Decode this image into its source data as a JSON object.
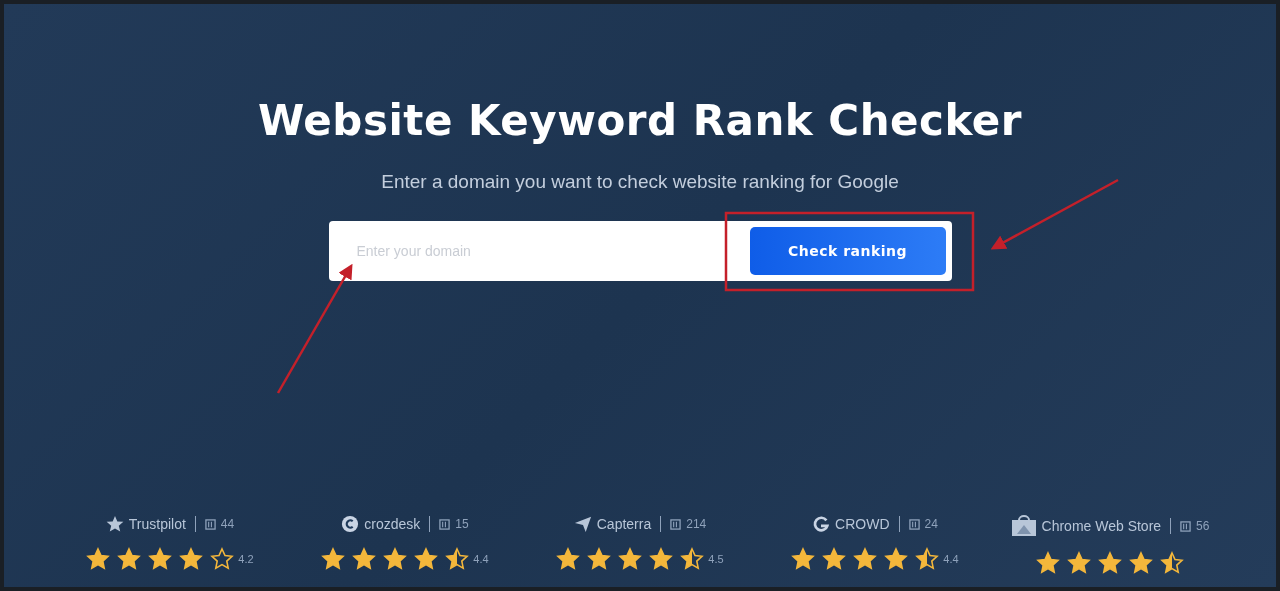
{
  "title": "Website Keyword Rank Checker",
  "subtitle": "Enter a domain you want to check website ranking for Google",
  "search": {
    "placeholder": "Enter your domain",
    "button": "Check ranking"
  },
  "reviews": [
    {
      "kind": "trustpilot",
      "name": "Trustpilot",
      "count": "44",
      "stars": 4,
      "rating": "4.2"
    },
    {
      "kind": "crozdesk",
      "name": "crozdesk",
      "count": "15",
      "stars": 4.5,
      "rating": "4.4"
    },
    {
      "kind": "capterra",
      "name": "Capterra",
      "count": "214",
      "stars": 4.5,
      "rating": "4.5"
    },
    {
      "kind": "g2",
      "name": "CROWD",
      "count": "24",
      "stars": 4.5,
      "rating": "4.4"
    },
    {
      "kind": "chrome",
      "name": "Chrome Web Store",
      "count": "56",
      "stars": 4.5
    }
  ],
  "annotations": [
    {
      "kind": "arrow"
    },
    {
      "kind": "box"
    },
    {
      "kind": "arrow"
    }
  ]
}
